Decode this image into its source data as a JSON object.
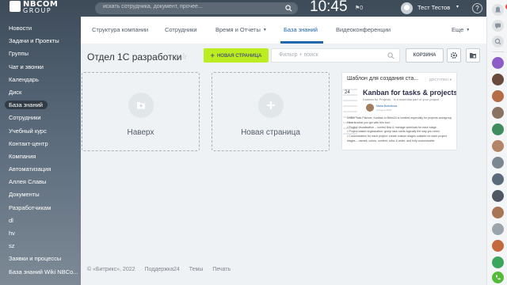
{
  "topbar": {
    "logo_line1": "NBCOM",
    "logo_line2": "GROUP",
    "search_placeholder": "искать сотрудника, документ, прочее...",
    "time": "10:45",
    "flag_count": "0",
    "user_name": "Тест Тестов",
    "help": "?"
  },
  "sidebar": {
    "items": [
      {
        "label": "Новости"
      },
      {
        "label": "Задачи и Проекты"
      },
      {
        "label": "Группы"
      },
      {
        "label": "Чат и звонки"
      },
      {
        "label": "Календарь"
      },
      {
        "label": "Диск"
      },
      {
        "label": "База знаний",
        "active": true
      },
      {
        "label": "Сотрудники"
      },
      {
        "label": "Учебный курс"
      },
      {
        "label": "Контакт-центр"
      },
      {
        "label": "Компания"
      },
      {
        "label": "Автоматизация"
      },
      {
        "label": "Аллея Славы"
      },
      {
        "label": "Документы"
      },
      {
        "label": "Разработчикам"
      },
      {
        "label": "dl"
      },
      {
        "label": "hv"
      },
      {
        "label": "sz"
      },
      {
        "label": "Заявки и процессы"
      },
      {
        "label": "База знаний Wiki NBCo..."
      }
    ]
  },
  "tabs": [
    {
      "label": "Структура компании"
    },
    {
      "label": "Сотрудники"
    },
    {
      "label": "Время и Отчеты"
    },
    {
      "label": "База знаний",
      "active": true
    },
    {
      "label": "Видеоконференции"
    },
    {
      "label": "Еще"
    }
  ],
  "page": {
    "title": "Отдел 1С разработки",
    "new_button": "НОВАЯ СТРАНИЦА",
    "filter_placeholder": "Фильтр + поиск",
    "trash_button": "КОРЗИНА"
  },
  "cards": {
    "up_label": "Наверх",
    "new_page_label": "Новая страница"
  },
  "template": {
    "title": "Шаблон для создания ста...",
    "badge": "ДОСТУПЕН",
    "number": "24",
    "heading": "Kanban for tasks & projects",
    "subheading": "Kanban for Projects · is a essential part of your project",
    "author": "Maria Bortnikova",
    "date": "2 August 2016",
    "lines": [
      "Unlike Task Planner, Kanban in Bitrix24 is created especially for projects workgroups",
      "Here is what you get with this tool:",
      "• Project visualization – control flow & manage workload for each stage.",
      "• Project-based organization: group task cards logically the way you need.",
      "• Customization for each project: create custom stages suitable for each project",
      "  stages – names, colors, content, color & order, and fully customizable"
    ]
  },
  "footer": {
    "copyright": "© «Битрикс», 2022",
    "support": "Поддержка24",
    "themes": "Темы",
    "print": "Печать"
  },
  "rail": {
    "notif_badge": "18"
  },
  "colors": {
    "accent_green": "#bbed21",
    "accent_blue": "#2067b0",
    "rail_badge": "#f5443b"
  }
}
